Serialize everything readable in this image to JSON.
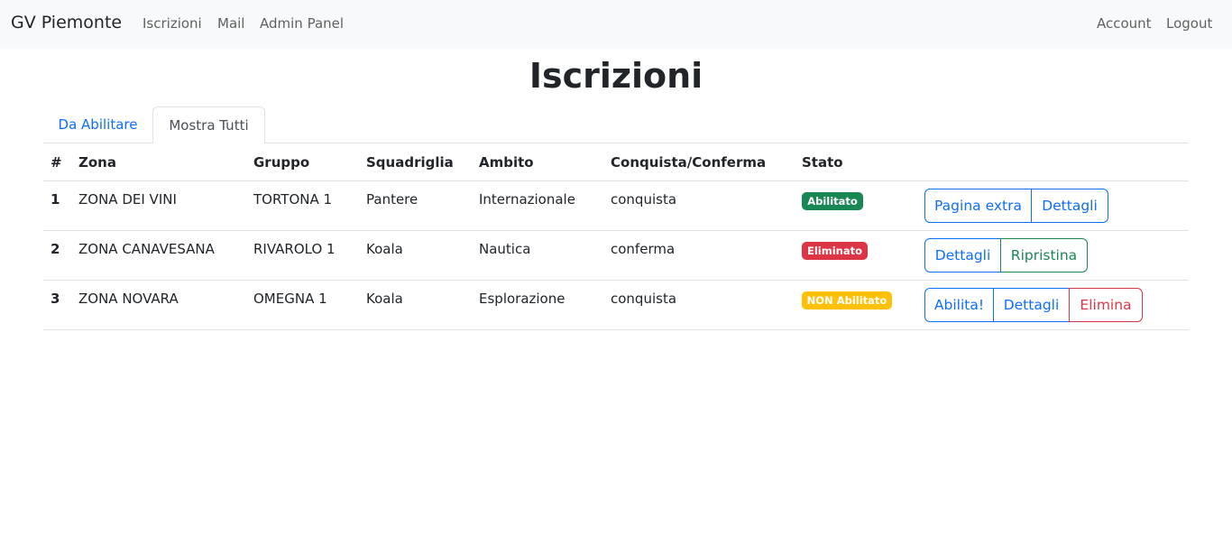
{
  "navbar": {
    "brand": "GV Piemonte",
    "links": [
      "Iscrizioni",
      "Mail",
      "Admin Panel"
    ],
    "right_links": [
      "Account",
      "Logout"
    ]
  },
  "page": {
    "title": "Iscrizioni"
  },
  "tabs": [
    {
      "label": "Da Abilitare",
      "active": false
    },
    {
      "label": "Mostra Tutti",
      "active": true
    }
  ],
  "table": {
    "headers": [
      "#",
      "Zona",
      "Gruppo",
      "Squadriglia",
      "Ambito",
      "Conquista/Conferma",
      "Stato"
    ],
    "rows": [
      {
        "num": "1",
        "zona": "ZONA DEI VINI",
        "gruppo": "TORTONA 1",
        "squadriglia": "Pantere",
        "ambito": "Internazionale",
        "cc": "conquista",
        "stato": {
          "label": "Abilitato",
          "color": "#198754"
        },
        "actions": [
          "Pagina extra",
          "Dettagli"
        ]
      },
      {
        "num": "2",
        "zona": "ZONA CANAVESANA",
        "gruppo": "RIVAROLO 1",
        "squadriglia": "Koala",
        "ambito": "Nautica",
        "cc": "conferma",
        "stato": {
          "label": "Eliminato",
          "color": "#dc3545"
        },
        "actions": [
          "Dettagli",
          "Ripristina"
        ]
      },
      {
        "num": "3",
        "zona": "ZONA NOVARA",
        "gruppo": "OMEGNA 1",
        "squadriglia": "Koala",
        "ambito": "Esplorazione",
        "cc": "conquista",
        "stato": {
          "label": "NON Abilitato",
          "color": "#ffc107"
        },
        "actions": [
          "Abilita!",
          "Dettagli",
          "Elimina"
        ]
      }
    ]
  },
  "colors": {
    "primary": "#0d6efd",
    "success": "#198754",
    "danger": "#dc3545",
    "warning": "#ffc107",
    "navbar_bg": "#f8f9fa"
  }
}
